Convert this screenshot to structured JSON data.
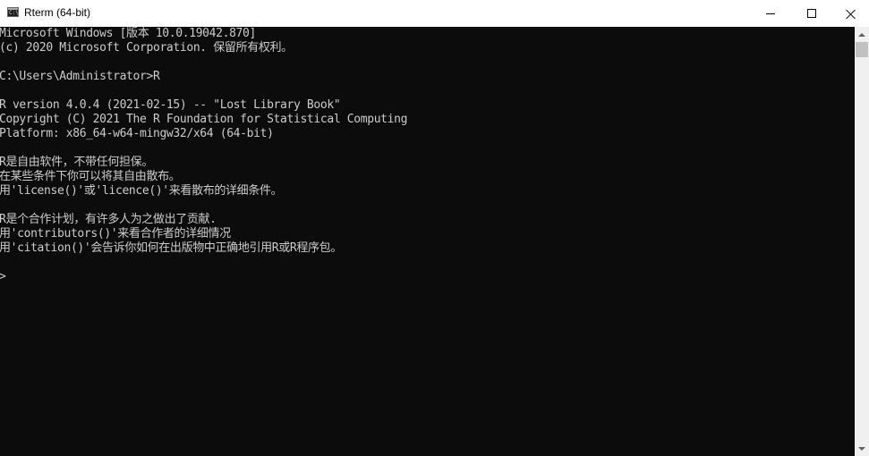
{
  "window": {
    "title": "Rterm (64-bit)",
    "icon_label": "C:\\",
    "icon_name": "console-icon"
  },
  "caption_buttons": {
    "minimize": "minimize-icon",
    "maximize": "maximize-icon",
    "close": "close-icon"
  },
  "console": {
    "text_color": "#cccccc",
    "background": "#0c0c0c",
    "lines": [
      "Microsoft Windows [版本 10.0.19042.870]",
      "(c) 2020 Microsoft Corporation. 保留所有权利。",
      "",
      "C:\\Users\\Administrator>R",
      "",
      "R version 4.0.4 (2021-02-15) -- \"Lost Library Book\"",
      "Copyright (C) 2021 The R Foundation for Statistical Computing",
      "Platform: x86_64-w64-mingw32/x64 (64-bit)",
      "",
      "R是自由软件，不带任何担保。",
      "在某些条件下你可以将其自由散布。",
      "用'license()'或'licence()'来看散布的详细条件。",
      "",
      "R是个合作计划，有许多人为之做出了贡献.",
      "用'contributors()'来看合作者的详细情况",
      "用'citation()'会告诉你如何在出版物中正确地引用R或R程序包。",
      "",
      ">"
    ]
  }
}
